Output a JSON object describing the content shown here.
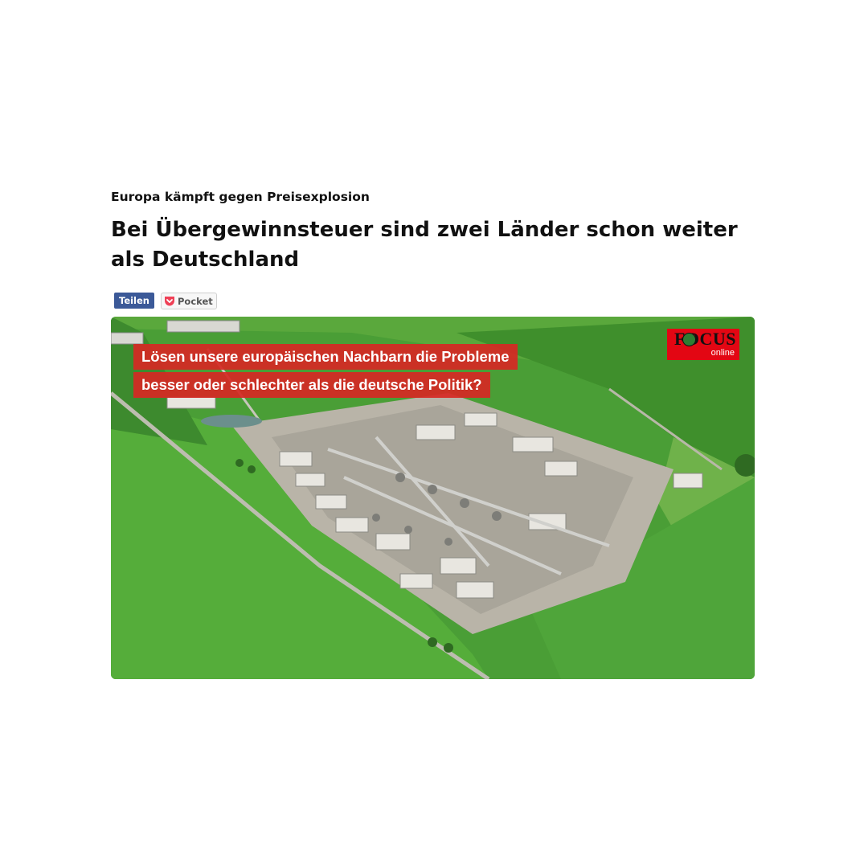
{
  "article": {
    "kicker": "Europa kämpft gegen Preisexplosion",
    "headline": "Bei Übergewinnsteuer sind zwei Länder schon weiter als Deutschland"
  },
  "share": {
    "teilen_label": "Teilen",
    "pocket_label": "Pocket"
  },
  "video": {
    "caption_line1": "Lösen unsere europäischen Nachbarn die Probleme",
    "caption_line2": "besser oder schlechter als die deutsche Politik?",
    "logo_word": "FOCUS",
    "logo_sub": "online"
  },
  "colors": {
    "facebook_blue": "#3b5998",
    "caption_red": "#d62824",
    "focus_red": "#e30613",
    "field_green": "#4fa53a"
  },
  "icons": {
    "pocket": "pocket-icon",
    "focus_globe": "globe-icon"
  }
}
